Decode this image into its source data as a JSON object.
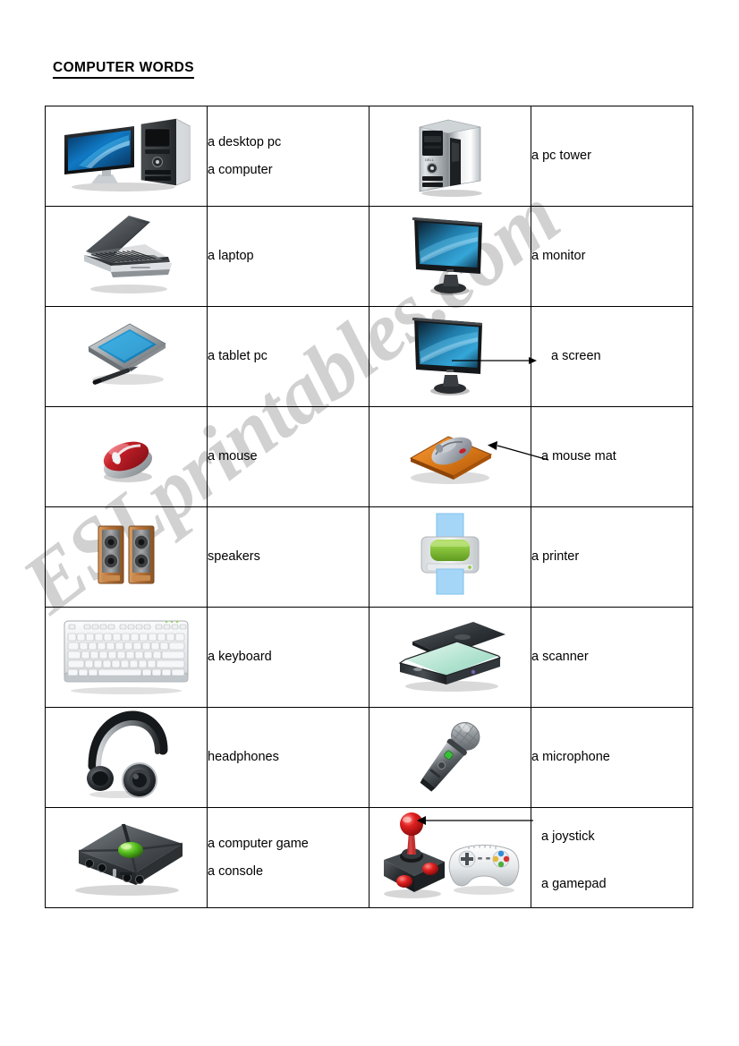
{
  "document": {
    "title": "COMPUTER WORDS",
    "watermark": "ESLprintables.com"
  },
  "table": {
    "rows": [
      {
        "left_image": "desktop-pc-image",
        "left_labels": [
          "a desktop pc",
          "a computer"
        ],
        "right_image": "pc-tower-image",
        "right_labels": [
          "a pc tower"
        ],
        "arrow": "none"
      },
      {
        "left_image": "laptop-image",
        "left_labels": [
          "a laptop"
        ],
        "right_image": "monitor-image",
        "right_labels": [
          "a monitor"
        ],
        "arrow": "none"
      },
      {
        "left_image": "tablet-pc-image",
        "left_labels": [
          "a tablet pc"
        ],
        "right_image": "monitor-screen-image",
        "right_labels": [
          "a screen"
        ],
        "arrow": "to-label"
      },
      {
        "left_image": "mouse-image",
        "left_labels": [
          "a mouse"
        ],
        "right_image": "mouse-mat-image",
        "right_labels": [
          "a mouse mat"
        ],
        "arrow": "to-image"
      },
      {
        "left_image": "speakers-image",
        "left_labels": [
          "speakers"
        ],
        "right_image": "printer-image",
        "right_labels": [
          "a printer"
        ],
        "arrow": "none"
      },
      {
        "left_image": "keyboard-image",
        "left_labels": [
          "a keyboard"
        ],
        "right_image": "scanner-image",
        "right_labels": [
          "a scanner"
        ],
        "arrow": "none"
      },
      {
        "left_image": "headphones-image",
        "left_labels": [
          "headphones"
        ],
        "right_image": "microphone-image",
        "right_labels": [
          "a microphone"
        ],
        "arrow": "none"
      },
      {
        "left_image": "games-console-image",
        "left_labels": [
          "a computer game",
          "a console"
        ],
        "right_image": "joystick-gamepad-image",
        "right_labels": [
          "a joystick",
          "a gamepad"
        ],
        "arrow": "to-image"
      }
    ]
  },
  "colors": {
    "border": "#000000",
    "text": "#000000",
    "watermark": "#c9c9c9",
    "screen_blue": "#1b8ec6",
    "mouse_red": "#c9202a",
    "mat_orange": "#e07b20",
    "printer_green": "#86c232",
    "printer_paper": "#9fd2f5",
    "console_green": "#5cc622",
    "joystick_red": "#e02020"
  }
}
